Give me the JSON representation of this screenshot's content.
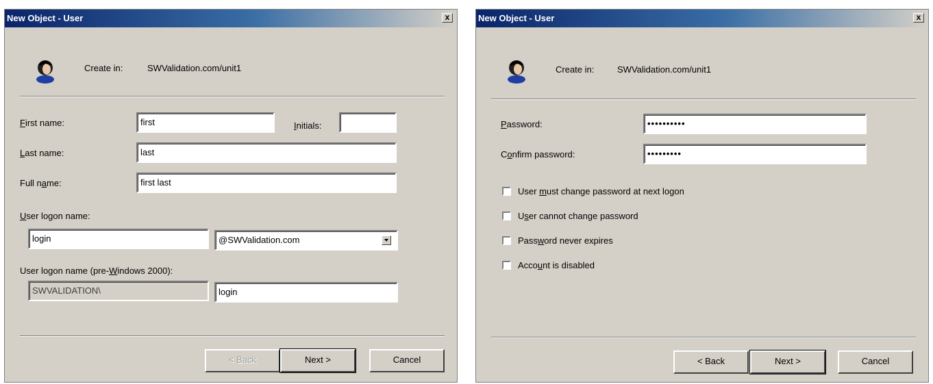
{
  "dialog1": {
    "title": "New Object - User",
    "close_glyph": "x",
    "create_in_label": "Create in:",
    "create_in_value": "SWValidation.com/unit1",
    "first_name": {
      "label_access": "F",
      "label_rest": "irst name:",
      "value": "first"
    },
    "initials": {
      "label_access": "I",
      "label_rest": "nitials:",
      "value": ""
    },
    "last_name": {
      "label_access": "L",
      "label_rest": "ast name:",
      "value": "last"
    },
    "full_name": {
      "label_pre": "Full n",
      "label_access": "a",
      "label_rest": "me:",
      "value": "first last"
    },
    "logon_name": {
      "label_access": "U",
      "label_rest": "ser logon name:",
      "value": "login"
    },
    "domain_select": {
      "value": "@SWValidation.com"
    },
    "pre2000": {
      "label_pre": "User logon name (pre-",
      "label_access": "W",
      "label_rest": "indows 2000):",
      "domain": "SWVALIDATION\\",
      "value": "login"
    },
    "buttons": {
      "back": "< Back",
      "next": "Next >",
      "cancel": "Cancel"
    }
  },
  "dialog2": {
    "title": "New Object - User",
    "close_glyph": "x",
    "create_in_label": "Create in:",
    "create_in_value": "SWValidation.com/unit1",
    "password": {
      "label_access": "P",
      "label_rest": "assword:",
      "value": "••••••••••"
    },
    "confirm": {
      "label_pre": "C",
      "label_access": "o",
      "label_rest": "nfirm password:",
      "value": "•••••••••"
    },
    "options": [
      {
        "pre": "User ",
        "access": "m",
        "rest": "ust change password at next logon",
        "checked": false
      },
      {
        "pre": "U",
        "access": "s",
        "rest": "er cannot change password",
        "checked": false
      },
      {
        "pre": "Pass",
        "access": "w",
        "rest": "ord never expires",
        "checked": false
      },
      {
        "pre": "Acco",
        "access": "u",
        "rest": "nt is disabled",
        "checked": false
      }
    ],
    "buttons": {
      "back": "< Back",
      "next": "Next >",
      "cancel": "Cancel"
    }
  }
}
